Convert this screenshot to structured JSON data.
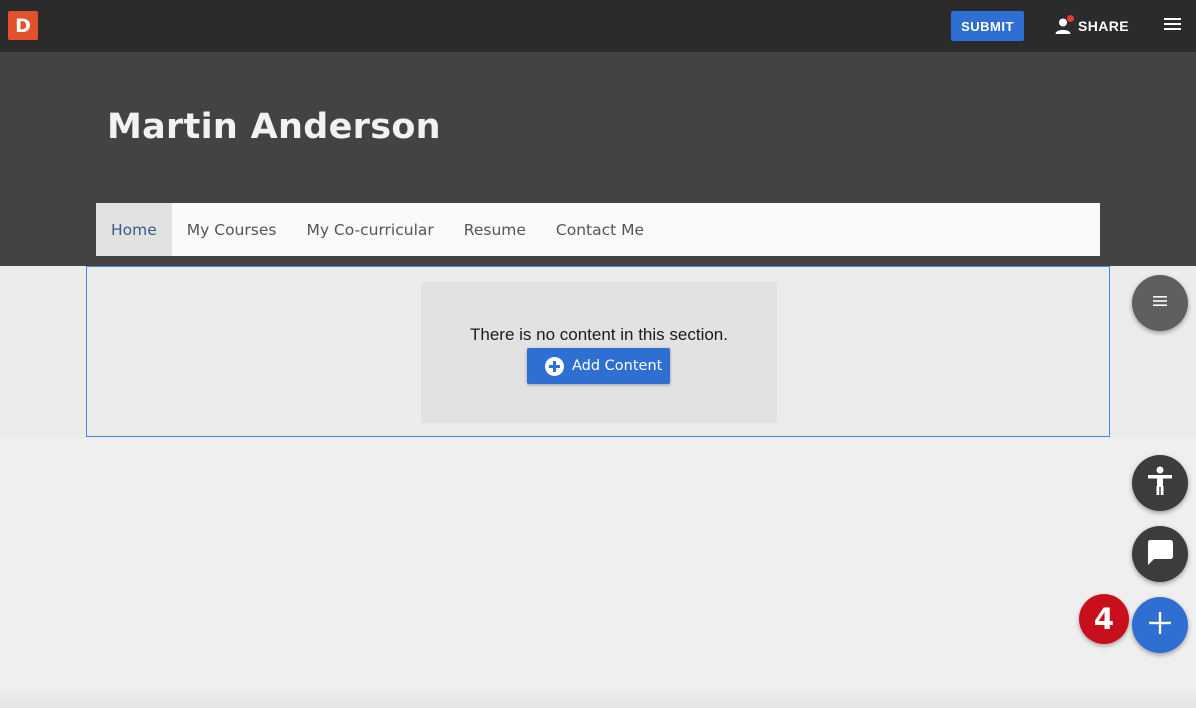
{
  "topbar": {
    "logo_letter": "D",
    "submit_label": "SUBMIT",
    "share_label": "SHARE"
  },
  "hero": {
    "title": "Martin Anderson"
  },
  "nav": {
    "items": [
      {
        "label": "Home",
        "active": true
      },
      {
        "label": "My Courses"
      },
      {
        "label": "My Co-curricular"
      },
      {
        "label": "Resume"
      },
      {
        "label": "Contact Me"
      }
    ]
  },
  "section": {
    "empty_message": "There is no content in this section.",
    "add_content_label": "Add Content"
  },
  "fabs": {
    "badge_count": "4"
  },
  "colors": {
    "accent": "#2f6fd1",
    "logo": "#e2502c",
    "badge": "#c8101c",
    "topbar": "#2b2b2b",
    "hero": "#434343"
  },
  "icons": [
    "person-icon",
    "menu-icon",
    "plus-circle-icon",
    "list-icon",
    "accessibility-icon",
    "chat-icon",
    "plus-icon"
  ]
}
